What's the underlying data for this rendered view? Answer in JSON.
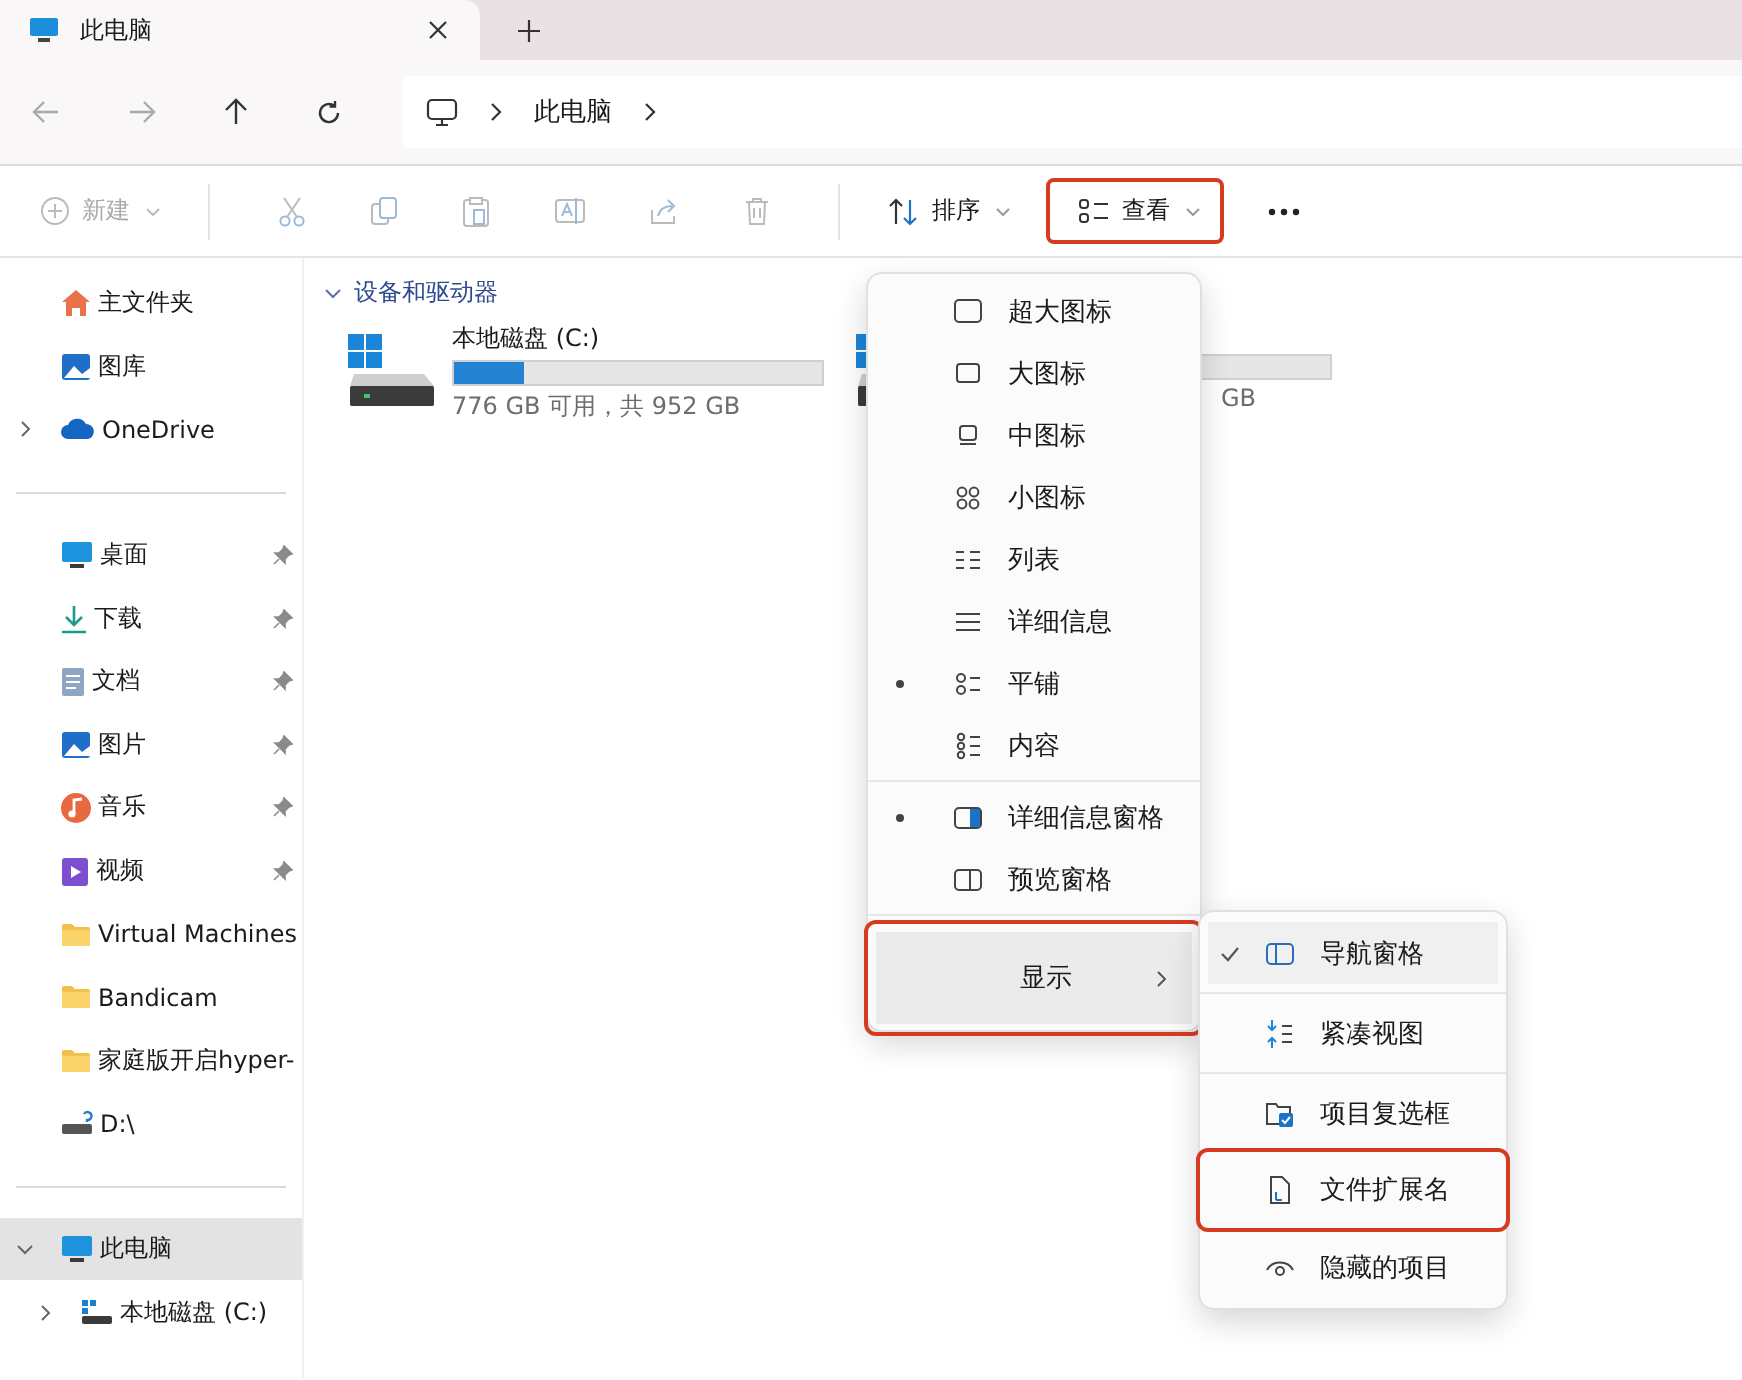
{
  "tab": {
    "title": "此电脑"
  },
  "address": {
    "crumbs": [
      "此电脑"
    ]
  },
  "toolbar": {
    "new_label": "新建",
    "sort_label": "排序",
    "view": {
      "label": "查看",
      "highlighted": true
    }
  },
  "sidebar": {
    "groups": [
      [
        {
          "kind": "home",
          "label": "主文件夹",
          "pinned": false
        },
        {
          "kind": "gallery",
          "label": "图库",
          "pinned": false
        },
        {
          "kind": "cloud",
          "label": "OneDrive",
          "pinned": false,
          "expanded": false
        }
      ],
      [
        {
          "kind": "desktop",
          "label": "桌面",
          "pinned": true
        },
        {
          "kind": "download",
          "label": "下载",
          "pinned": true
        },
        {
          "kind": "documents",
          "label": "文档",
          "pinned": true
        },
        {
          "kind": "pictures",
          "label": "图片",
          "pinned": true
        },
        {
          "kind": "music",
          "label": "音乐",
          "pinned": true
        },
        {
          "kind": "videos",
          "label": "视频",
          "pinned": true
        },
        {
          "kind": "folder",
          "label": "Virtual Machines",
          "pinned": false
        },
        {
          "kind": "folder",
          "label": "Bandicam",
          "pinned": false
        },
        {
          "kind": "folder",
          "label": "家庭版开启hyper-",
          "pinned": false
        },
        {
          "kind": "netdrive",
          "label": "D:\\",
          "pinned": false
        }
      ],
      [
        {
          "kind": "pc",
          "label": "此电脑",
          "pinned": false,
          "expanded": true,
          "selected": true,
          "children": [
            {
              "kind": "disk",
              "label": "本地磁盘 (C:)",
              "expanded": false,
              "selected": false
            }
          ]
        }
      ]
    ]
  },
  "section": {
    "title": "设备和驱动器",
    "expanded": true
  },
  "drives": [
    {
      "name": "本地磁盘 (C:)",
      "level": 0.19,
      "caption": "776 GB 可用，共 952 GB"
    },
    {
      "caption": "GB"
    }
  ],
  "view_menu": {
    "groups": [
      [
        {
          "kind": "xl",
          "label": "超大图标",
          "selected": false
        },
        {
          "kind": "lg",
          "label": "大图标",
          "selected": false
        },
        {
          "kind": "md",
          "label": "中图标",
          "selected": false
        },
        {
          "kind": "sm",
          "label": "小图标",
          "selected": false
        },
        {
          "kind": "list",
          "label": "列表",
          "selected": false
        },
        {
          "kind": "details",
          "label": "详细信息",
          "selected": false
        },
        {
          "kind": "tiles",
          "label": "平铺",
          "selected": true
        },
        {
          "kind": "content",
          "label": "内容",
          "selected": false
        }
      ],
      [
        {
          "kind": "detailspane",
          "label": "详细信息窗格",
          "selected": true
        },
        {
          "kind": "previewpane",
          "label": "预览窗格",
          "selected": false
        }
      ],
      [
        {
          "kind": "submenu",
          "label": "显示",
          "expanded": true,
          "highlighted": true
        }
      ]
    ]
  },
  "show_menu": {
    "groups": [
      [
        {
          "kind": "navpane",
          "label": "导航窗格",
          "checked": true,
          "highlighted": false
        }
      ],
      [
        {
          "kind": "compact",
          "label": "紧凑视图",
          "checked": false,
          "highlighted": false
        }
      ],
      [
        {
          "kind": "checkboxes",
          "label": "项目复选框",
          "checked": false,
          "highlighted": false
        },
        {
          "kind": "extensions",
          "label": "文件扩展名",
          "checked": false,
          "highlighted": true
        },
        {
          "kind": "hidden",
          "label": "隐藏的项目",
          "checked": false,
          "highlighted": false
        }
      ]
    ]
  }
}
